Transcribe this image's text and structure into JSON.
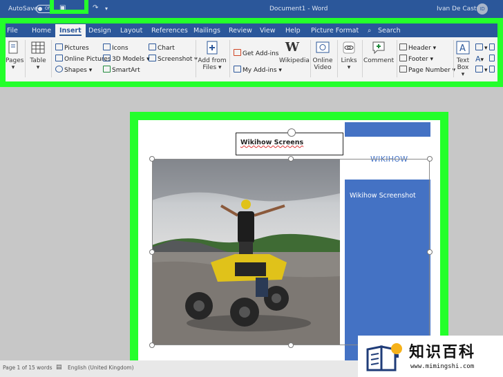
{
  "titlebar": {
    "autosave_label": "AutoSave",
    "autosave_state": "Off",
    "document_title": "Document1 - Word",
    "user_name": "Ivan De Castro",
    "user_initials": "ID"
  },
  "tabs": [
    "File",
    "Home",
    "Insert",
    "Design",
    "Layout",
    "References",
    "Mailings",
    "Review",
    "View",
    "Help",
    "Picture Format",
    "Search"
  ],
  "active_tab": "Insert",
  "ribbon": {
    "pages": "Pages",
    "table": "Table",
    "pictures": "Pictures",
    "online_pictures": "Online Pictures",
    "shapes": "Shapes",
    "icons": "Icons",
    "models_3d": "3D Models",
    "smartart": "SmartArt",
    "chart": "Chart",
    "screenshot": "Screenshot",
    "add_from_files": "Add from Files",
    "get_addins": "Get Add-ins",
    "my_addins": "My Add-ins",
    "wikipedia": "Wikipedia",
    "online_video": "Online Video",
    "links": "Links",
    "comment": "Comment",
    "header": "Header",
    "footer": "Footer",
    "page_number": "Page Number",
    "text_box": "Text Box"
  },
  "document": {
    "textbox_text": "Wikihow Screens",
    "wikihow_heading": "WIKIHOW",
    "sidebar_text": "Wikihow Screenshot"
  },
  "status": {
    "page": "Page 1 of 1",
    "words": "5 words",
    "language": "English (United Kingdom)"
  },
  "watermark": {
    "title": "知识百科",
    "url": "www.mimingshi.com"
  },
  "colors": {
    "word_blue": "#2b579a",
    "accent_blue": "#4472c4",
    "highlight_green": "#24ff2b"
  }
}
